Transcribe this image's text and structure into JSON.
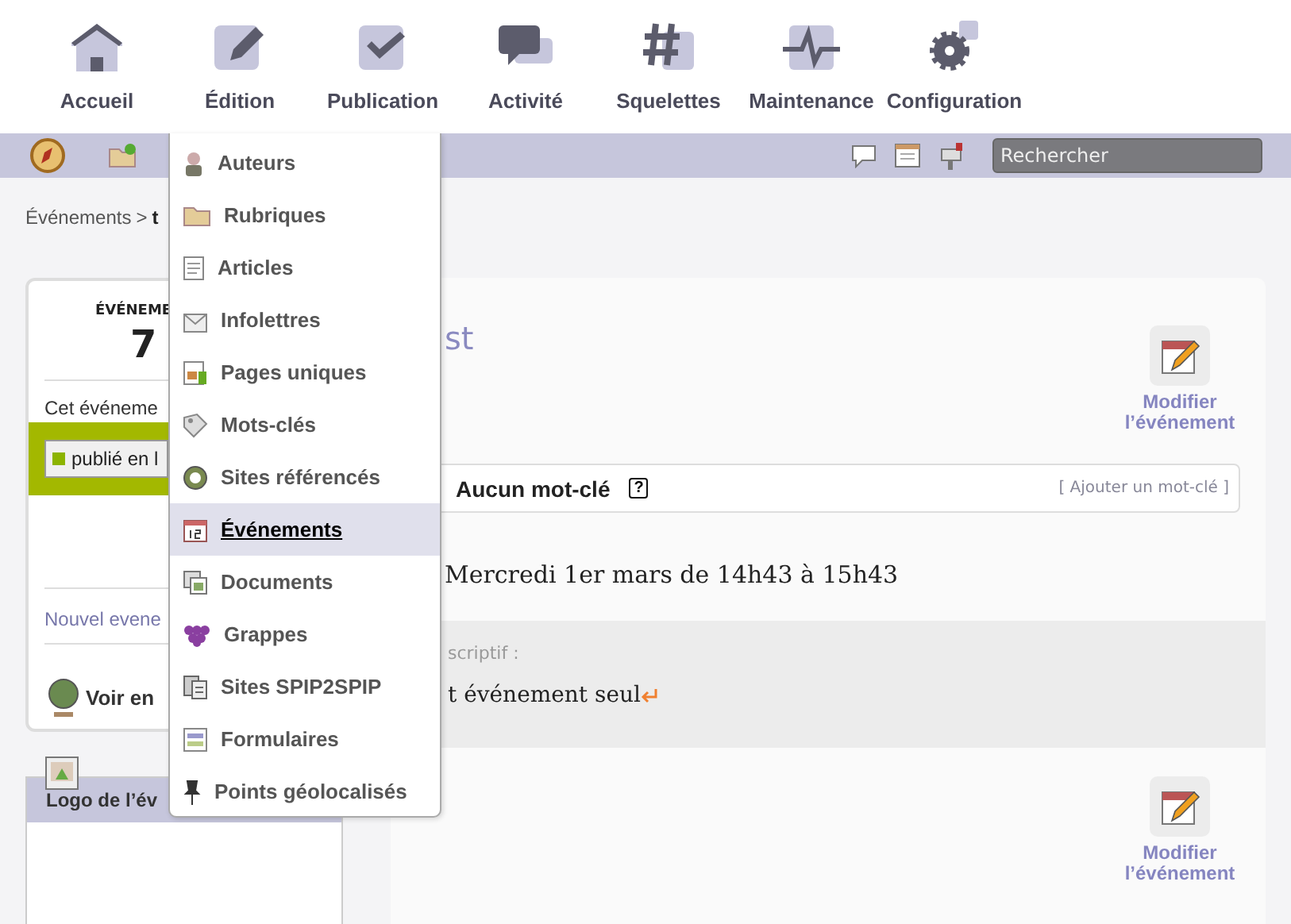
{
  "nav": [
    {
      "label": "Accueil"
    },
    {
      "label": "Édition"
    },
    {
      "label": "Publication"
    },
    {
      "label": "Activité"
    },
    {
      "label": "Squelettes"
    },
    {
      "label": "Maintenance"
    },
    {
      "label": "Configuration"
    }
  ],
  "toolbar": {
    "search": {
      "placeholder": "Rechercher"
    }
  },
  "breadcrumb": {
    "parent": "Événements",
    "separator": ">",
    "current": "t"
  },
  "event_card": {
    "heading": "ÉVÉNEME",
    "number": "7",
    "status_label": "Cet événeme",
    "status_value": "publié en l",
    "new_link": "Nouvel evene",
    "view_link": "Voir en"
  },
  "logo_box": {
    "title": "Logo de l’év"
  },
  "main": {
    "title": "st",
    "edit_button": "Modifier l’événement",
    "keywords": {
      "label": "Aucun mot-clé",
      "help": "?",
      "add_link": "[ Ajouter un mot-clé ]"
    },
    "date": "Mercredi 1er mars de 14h43 à 15h43",
    "description": {
      "label": "scriptif :",
      "text": "t événement seul"
    },
    "edit_button_2": "Modifier l’événement"
  },
  "menu": {
    "items": [
      {
        "label": "Auteurs",
        "selected": false
      },
      {
        "label": "Rubriques",
        "selected": false
      },
      {
        "label": "Articles",
        "selected": false
      },
      {
        "label": "Infolettres",
        "selected": false
      },
      {
        "label": "Pages uniques",
        "selected": false
      },
      {
        "label": "Mots-clés",
        "selected": false
      },
      {
        "label": "Sites référencés",
        "selected": false
      },
      {
        "label": "Événements",
        "selected": true
      },
      {
        "label": "Documents",
        "selected": false
      },
      {
        "label": "Grappes",
        "selected": false
      },
      {
        "label": "Sites SPIP2SPIP",
        "selected": false
      },
      {
        "label": "Formulaires",
        "selected": false
      },
      {
        "label": "Points géolocalisés",
        "selected": false
      }
    ]
  }
}
